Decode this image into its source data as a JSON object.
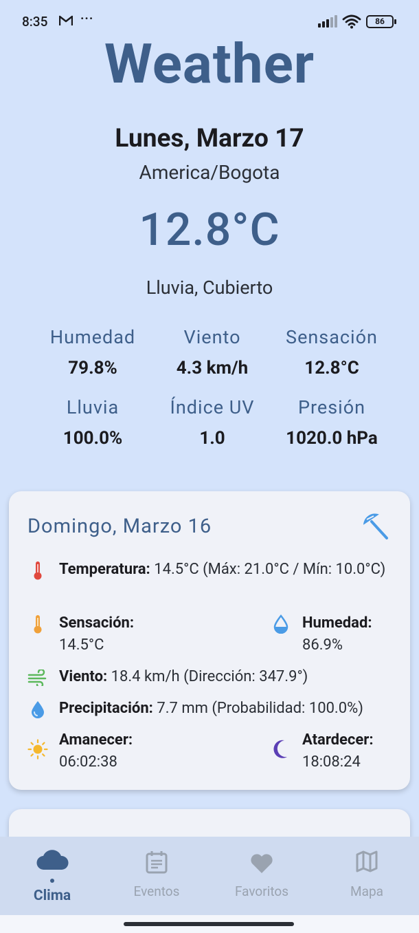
{
  "status_bar": {
    "time": "8:35",
    "dots": "···",
    "battery": "86"
  },
  "app": {
    "title": "Weather"
  },
  "current": {
    "date": "Lunes, Marzo 17",
    "timezone": "America/Bogota",
    "temperature": "12.8°C",
    "description": "Lluvia, Cubierto"
  },
  "stats": [
    {
      "label": "Humedad",
      "value": "79.8%"
    },
    {
      "label": "Viento",
      "value": "4.3 km/h"
    },
    {
      "label": "Sensación",
      "value": "12.8°C"
    },
    {
      "label": "Lluvia",
      "value": "100.0%"
    },
    {
      "label": "Índice UV",
      "value": "1.0"
    },
    {
      "label": "Presión",
      "value": "1020.0 hPa"
    }
  ],
  "forecast_card": {
    "title": "Domingo, Marzo 16",
    "weather_icon": "umbrella-beach-icon",
    "temperature_label": "Temperatura:",
    "temperature_value": "14.5°C (Máx: 21.0°C / Mín: 10.0°C)",
    "feels_label": "Sensación:",
    "feels_value": "14.5°C",
    "humidity_label": "Humedad:",
    "humidity_value": "86.9%",
    "wind_label": "Viento:",
    "wind_value": "18.4 km/h (Dirección: 347.9°)",
    "precip_label": "Precipitación:",
    "precip_value": "7.7 mm (Probabilidad: 100.0%)",
    "sunrise_label": "Amanecer:",
    "sunrise_value": "06:02:38",
    "sunset_label": "Atardecer:",
    "sunset_value": "18:08:24"
  },
  "nav": [
    {
      "label": "Clima",
      "icon": "cloud-icon",
      "active": true
    },
    {
      "label": "Eventos",
      "icon": "calendar-icon",
      "active": false
    },
    {
      "label": "Favoritos",
      "icon": "heart-icon",
      "active": false
    },
    {
      "label": "Mapa",
      "icon": "map-icon",
      "active": false
    }
  ],
  "colors": {
    "background": "#d4e3fb",
    "accent": "#3e5f8a",
    "card": "#f0f2f8",
    "thermometer_red": "#e0483e",
    "thermometer_orange": "#f0a13a",
    "water_blue": "#4a9be6",
    "wind_green": "#5cb85c",
    "sun_yellow": "#f5b82e",
    "moon_purple": "#5b3fb5"
  }
}
